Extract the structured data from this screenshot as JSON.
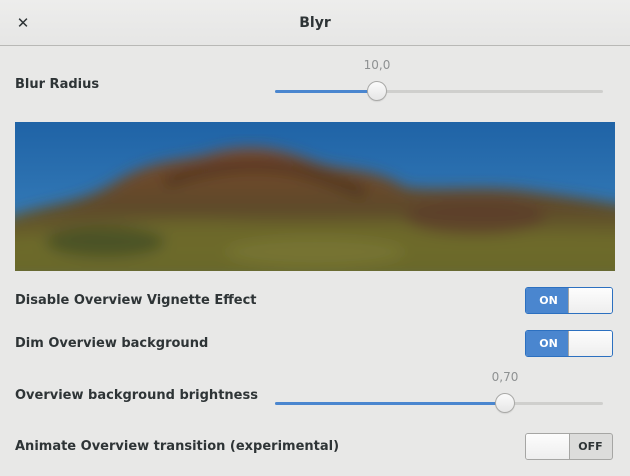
{
  "window": {
    "title": "Blyr",
    "close_glyph": "✕",
    "close_icon": "close-icon"
  },
  "blur_radius": {
    "label": "Blur Radius",
    "value_text": "10,0",
    "fraction": 0.31
  },
  "preview": {
    "description_icon": "blurred-landscape-preview"
  },
  "disable_vignette": {
    "label": "Disable Overview Vignette Effect",
    "state": "ON",
    "on_text": "ON",
    "off_text": "OFF"
  },
  "dim_background": {
    "label": "Dim Overview background",
    "state": "ON",
    "on_text": "ON",
    "off_text": "OFF"
  },
  "brightness": {
    "label": "Overview background brightness",
    "value_text": "0,70",
    "fraction": 0.7
  },
  "animate_transition": {
    "label": "Animate Overview transition (experimental)",
    "state": "OFF",
    "on_text": "ON",
    "off_text": "OFF"
  },
  "colors": {
    "accent": "#4a86cf",
    "background": "#e8e8e7"
  }
}
